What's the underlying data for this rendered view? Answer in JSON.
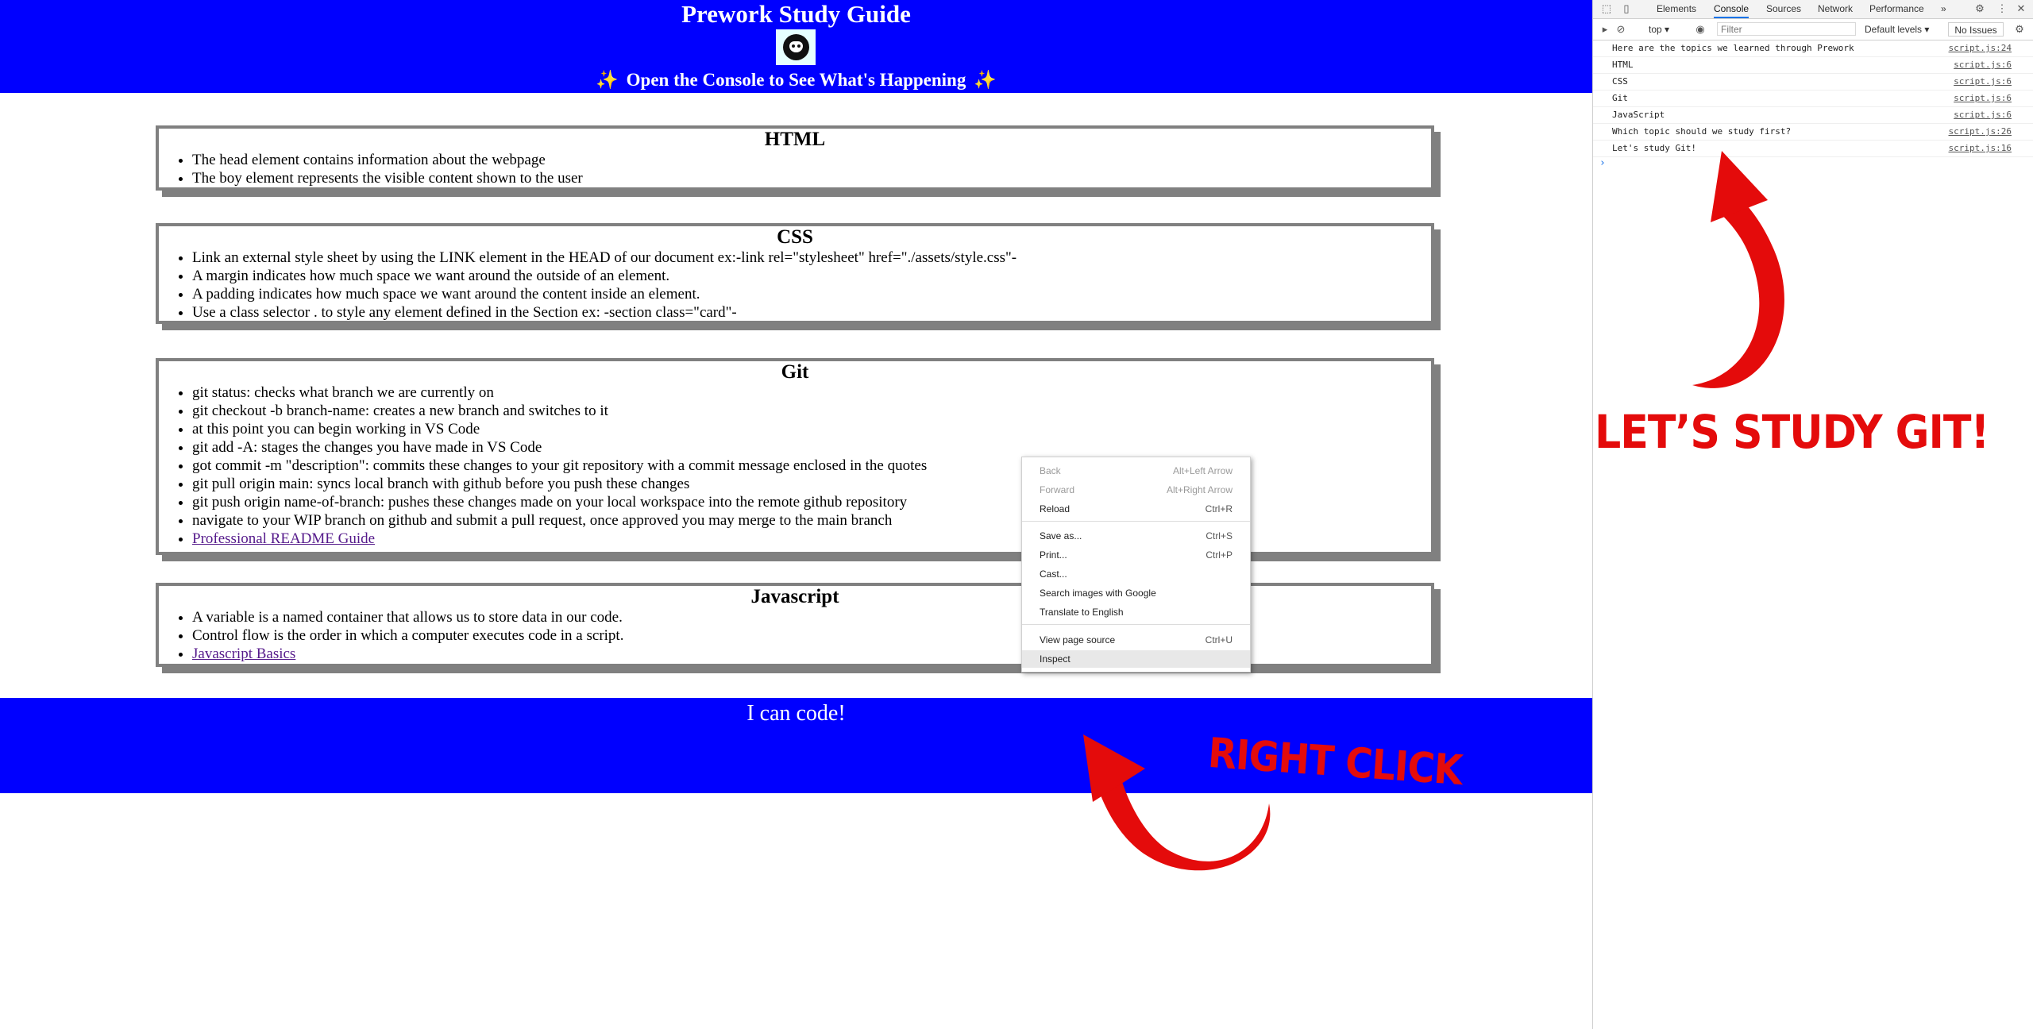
{
  "site": {
    "title": "Prework Study Guide",
    "subtitle": "Open the Console to See What's Happening",
    "sparkle": "✨",
    "footer": "I can code!"
  },
  "cards": {
    "html": {
      "heading": "HTML",
      "items": [
        "The head element contains information about the webpage",
        "The boy element represents the visible content shown to the user"
      ]
    },
    "css": {
      "heading": "CSS",
      "items": [
        "Link an external style sheet by using the LINK element in the HEAD of our document ex:-link rel=\"stylesheet\" href=\"./assets/style.css\"-",
        "A margin indicates how much space we want around the outside of an element.",
        "A padding indicates how much space we want around the content inside an element.",
        "Use a class selector . to style any element defined in the Section ex: -section class=\"card\"-"
      ]
    },
    "git": {
      "heading": "Git",
      "items": [
        "git status: checks what branch we are currently on",
        "git checkout -b branch-name: creates a new branch and switches to it",
        "at this point you can begin working in VS Code",
        "git add -A: stages the changes you have made in VS Code",
        "got commit -m \"description\": commits these changes to your git repository with a commit message enclosed in the quotes",
        "git pull origin main: syncs local branch with github before you push these changes",
        "git push origin name-of-branch: pushes these changes made on your local workspace into the remote github repository",
        "navigate to your WIP branch on github and submit a pull request, once approved you may merge to the main branch"
      ],
      "link": "Professional README Guide"
    },
    "js": {
      "heading": "Javascript",
      "items": [
        "A variable is a named container that allows us to store data in our code.",
        "Control flow is the order in which a computer executes code in a script."
      ],
      "link": "Javascript Basics"
    }
  },
  "context_menu": {
    "back": {
      "label": "Back",
      "shortcut": "Alt+Left Arrow"
    },
    "forward": {
      "label": "Forward",
      "shortcut": "Alt+Right Arrow"
    },
    "reload": {
      "label": "Reload",
      "shortcut": "Ctrl+R"
    },
    "save_as": {
      "label": "Save as...",
      "shortcut": "Ctrl+S"
    },
    "print": {
      "label": "Print...",
      "shortcut": "Ctrl+P"
    },
    "cast": {
      "label": "Cast..."
    },
    "search_images": {
      "label": "Search images with Google"
    },
    "translate": {
      "label": "Translate to English"
    },
    "view_source": {
      "label": "View page source",
      "shortcut": "Ctrl+U"
    },
    "inspect": {
      "label": "Inspect"
    }
  },
  "annotations": {
    "right_click": "RIGHT CLICK",
    "lets_study_git": "LET’S STUDY GIT!",
    "color": "#e40b0b"
  },
  "devtools": {
    "tabs": [
      "Elements",
      "Console",
      "Sources",
      "Network",
      "Performance"
    ],
    "active_tab": "Console",
    "more_tabs": "»",
    "context": "top",
    "filter_placeholder": "Filter",
    "levels": "Default levels",
    "issues": "No Issues",
    "logs": [
      {
        "message": "Here are the topics we learned through Prework",
        "source": "script.js:24"
      },
      {
        "message": "HTML",
        "source": "script.js:6"
      },
      {
        "message": "CSS",
        "source": "script.js:6"
      },
      {
        "message": "Git",
        "source": "script.js:6"
      },
      {
        "message": "JavaScript",
        "source": "script.js:6"
      },
      {
        "message": "Which topic should we study first?",
        "source": "script.js:26"
      },
      {
        "message": "Let's study Git!",
        "source": "script.js:16"
      }
    ],
    "prompt": "›"
  },
  "colors": {
    "header_bg": "#0000ff",
    "card_border": "#808080",
    "link": "#551a8b",
    "arrow": "#e40b0b"
  }
}
